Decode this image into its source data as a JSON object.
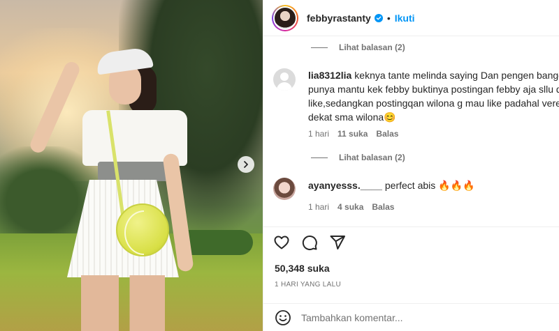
{
  "post": {
    "author": "febbyrastanty",
    "separator": "•",
    "follow_label": "Ikuti",
    "likes": "50,348 suka",
    "time_ago": "1 HARI YANG LALU"
  },
  "comments": [
    {
      "view_replies": "Lihat balasan (2)"
    },
    {
      "user": "lia8312lia",
      "lines": [
        "keknya tante melinda saying Dan pengen banget y",
        "punya mantu kek febby buktinya postingan febby aja sllu di",
        "like,sedangkan postingqan wilona g mau like padahal verell",
        "dekat sma wilona😊"
      ],
      "time": "1 hari",
      "likes": "11 suka",
      "reply": "Balas",
      "view_replies": "Lihat balasan (2)"
    },
    {
      "user": "ayanyesss.____",
      "text": "perfect abis 🔥🔥🔥",
      "time": "1 hari",
      "likes": "4 suka",
      "reply": "Balas"
    }
  ],
  "add_comment": {
    "placeholder": "Tambahkan komentar..."
  },
  "colors": {
    "accent": "#0095f6",
    "text": "#262626",
    "muted": "#737373"
  },
  "icons": [
    "verified-badge-icon",
    "heart-icon",
    "comment-icon",
    "share-icon",
    "emoji-icon",
    "chevron-right-icon"
  ]
}
